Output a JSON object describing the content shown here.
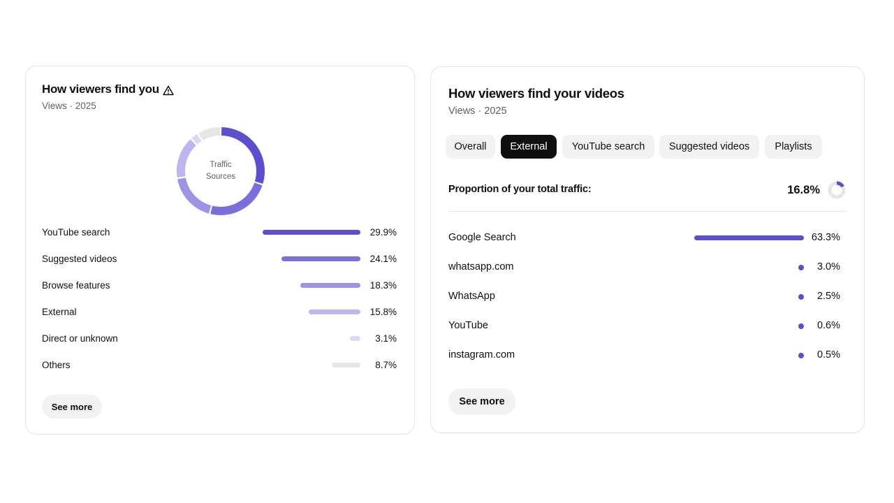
{
  "left_card": {
    "title": "How viewers find you",
    "subtitle": "Views · 2025",
    "donut_center_line1": "Traffic",
    "donut_center_line2": "Sources",
    "sources": [
      {
        "label": "YouTube search",
        "value": 29.9,
        "pct": "29.9%",
        "color": "#5b4fcf"
      },
      {
        "label": "Suggested videos",
        "value": 24.1,
        "pct": "24.1%",
        "color": "#7b6fdb"
      },
      {
        "label": "Browse features",
        "value": 18.3,
        "pct": "18.3%",
        "color": "#9d94e4"
      },
      {
        "label": "External",
        "value": 15.8,
        "pct": "15.8%",
        "color": "#bdb7ee"
      },
      {
        "label": "Direct or unknown",
        "value": 3.1,
        "pct": "3.1%",
        "color": "#dcd9f6"
      },
      {
        "label": "Others",
        "value": 8.7,
        "pct": "8.7%",
        "color": "#e6e6e6"
      }
    ],
    "see_more_label": "See more"
  },
  "right_card": {
    "title": "How viewers find your videos",
    "subtitle": "Views · 2025",
    "tabs": [
      {
        "label": "Overall",
        "active": false
      },
      {
        "label": "External",
        "active": true
      },
      {
        "label": "YouTube search",
        "active": false
      },
      {
        "label": "Suggested videos",
        "active": false
      },
      {
        "label": "Playlists",
        "active": false
      }
    ],
    "proportion_label": "Proportion of your total traffic:",
    "proportion_value": "16.8%",
    "proportion_fraction": 0.168,
    "sources": [
      {
        "label": "Google Search",
        "value": 63.3,
        "pct": "63.3%"
      },
      {
        "label": "whatsapp.com",
        "value": 3.0,
        "pct": "3.0%"
      },
      {
        "label": "WhatsApp",
        "value": 2.5,
        "pct": "2.5%"
      },
      {
        "label": "YouTube",
        "value": 0.6,
        "pct": "0.6%"
      },
      {
        "label": "instagram.com",
        "value": 0.5,
        "pct": "0.5%"
      }
    ],
    "see_more_label": "See more"
  },
  "colors": {
    "accent": "#5b4fcf",
    "chip_bg": "#f2f2f2",
    "chip_active_bg": "#0f0f0f"
  },
  "icons": {
    "warning": "warning-icon"
  }
}
